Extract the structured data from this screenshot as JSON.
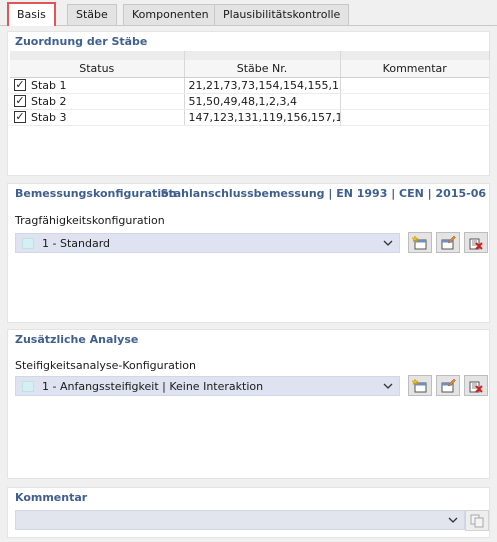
{
  "tabs": [
    {
      "label": "Basis"
    },
    {
      "label": "Stäbe"
    },
    {
      "label": "Komponenten"
    },
    {
      "label": "Plausibilitätskontrolle"
    }
  ],
  "members": {
    "title": "Zuordnung der Stäbe",
    "columns": [
      "Status",
      "Stäbe Nr.",
      "Kommentar"
    ],
    "rows": [
      {
        "status": "Stab 1",
        "checked": true,
        "nums": "21,21,73,73,154,154,155,155",
        "comment": ""
      },
      {
        "status": "Stab 2",
        "checked": true,
        "nums": "51,50,49,48,1,2,3,4",
        "comment": ""
      },
      {
        "status": "Stab 3",
        "checked": true,
        "nums": "147,123,131,119,156,157,1...",
        "comment": ""
      }
    ]
  },
  "design": {
    "title": "Bemessungskonfiguration",
    "standard": "Stahlanschlussbemessung | EN 1993 | CEN | 2015-06",
    "label": "Tragfähigkeitskonfiguration",
    "value": "1 - Standard"
  },
  "analysis": {
    "title": "Zusätzliche Analyse",
    "label": "Steifigkeitsanalyse-Konfiguration",
    "value": "1 - Anfangssteifigkeit | Keine Interaktion"
  },
  "comment": {
    "title": "Kommentar",
    "value": ""
  },
  "icons": {
    "new": "new-config-icon",
    "edit": "edit-config-icon",
    "delete": "delete-config-icon",
    "copy": "copy-icon",
    "dropdown": "chevron-down-icon"
  },
  "colors": {
    "active_tab_outline": "#e05555",
    "section_title": "#3f5f8f",
    "combo_bg": "#dfe2f0",
    "swatch": "#d4f0f2"
  }
}
